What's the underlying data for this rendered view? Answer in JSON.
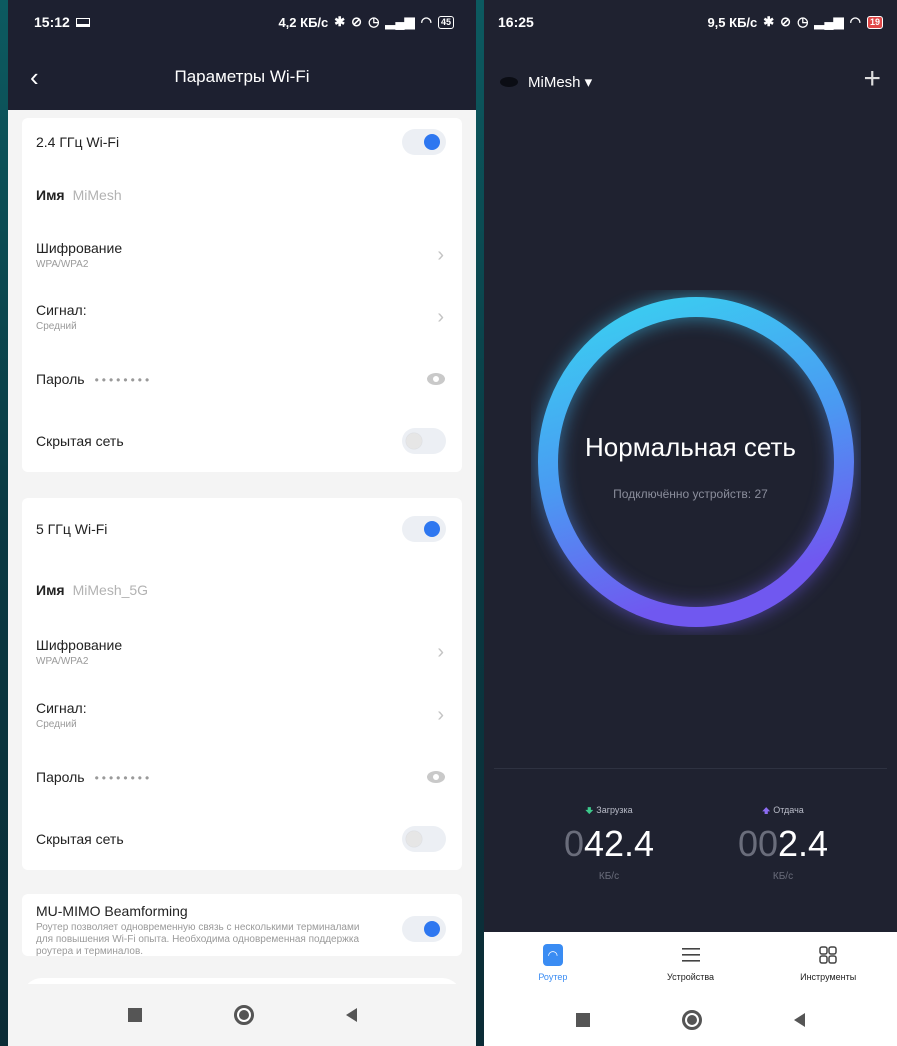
{
  "left": {
    "status": {
      "time": "15:12",
      "speed": "4,2 КБ/с",
      "battery": "45"
    },
    "header": {
      "back_icon": "chevron-left-icon",
      "title": "Параметры Wi-Fi"
    },
    "band24": {
      "toggle_label": "2.4 ГГц Wi-Fi",
      "toggle_on": true,
      "name_label": "Имя",
      "name_value": "MiMesh",
      "enc_label": "Шифрование",
      "enc_value": "WPA/WPA2",
      "signal_label": "Сигнал:",
      "signal_value": "Средний",
      "pass_label": "Пароль",
      "pass_value": "••••••••",
      "hidden_label": "Скрытая сеть",
      "hidden_on": false
    },
    "band5": {
      "toggle_label": "5 ГГц Wi-Fi",
      "toggle_on": true,
      "name_label": "Имя",
      "name_value": "MiMesh_5G",
      "enc_label": "Шифрование",
      "enc_value": "WPA/WPA2",
      "signal_label": "Сигнал:",
      "signal_value": "Средний",
      "pass_label": "Пароль",
      "pass_value": "••••••••",
      "hidden_label": "Скрытая сеть",
      "hidden_on": false
    },
    "mumimo": {
      "title": "MU-MIMO Beamforming",
      "desc": "Роутер позволяет одновременную связь с несколькими терминалами для повышения Wi-Fi опыта. Необходима одновременная поддержка роутера и терминалов.",
      "on": true
    }
  },
  "right": {
    "status": {
      "time": "16:25",
      "speed": "9,5 КБ/с",
      "battery": "19"
    },
    "network_name": "MiMesh ▾",
    "status_title": "Нормальная сеть",
    "connected": "Подключённо устройств: 27",
    "download": {
      "label": "Загрузка",
      "dim": "0",
      "value": "42.4",
      "unit": "КБ/с"
    },
    "upload": {
      "label": "Отдача",
      "dim": "00",
      "value": "2.4",
      "unit": "КБ/с"
    },
    "tabs": [
      {
        "label": "Роутер",
        "icon": "router-icon"
      },
      {
        "label": "Устройства",
        "icon": "list-icon"
      },
      {
        "label": "Инструменты",
        "icon": "grid-icon"
      }
    ],
    "colors": {
      "ring_start": "#39d3f1",
      "ring_end": "#7058f0",
      "accent": "#2e77f0",
      "background": "#1f2230"
    }
  }
}
